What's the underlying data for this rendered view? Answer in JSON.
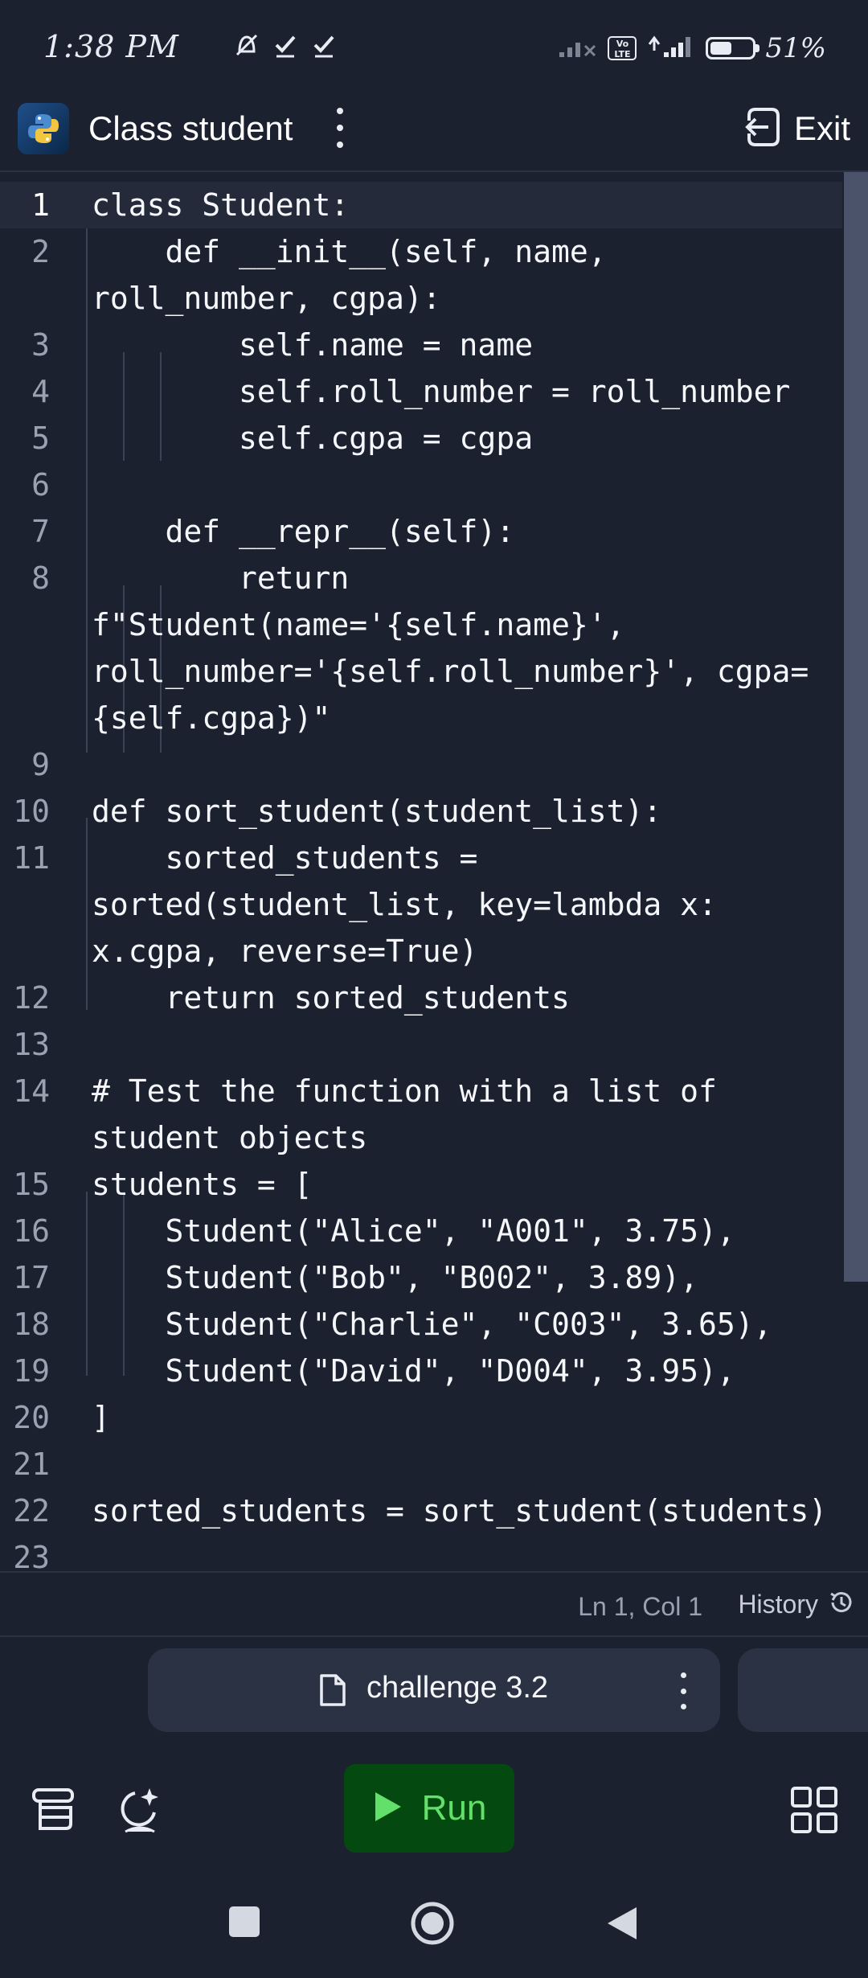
{
  "status_bar": {
    "time": "1:38 PM",
    "battery_text": "51%",
    "battery_level_percent": 51,
    "network_badge": "Vo LTE",
    "icons": [
      "dnd-icon",
      "check-icon",
      "check-icon",
      "signal-icon",
      "signal-icon"
    ]
  },
  "header": {
    "title": "Class student",
    "exit_label": "Exit",
    "logo_icon": "python-logo"
  },
  "editor": {
    "lines": [
      {
        "number": "1",
        "text": "class Student:"
      },
      {
        "number": "2",
        "text": "    def __init__(self, name,"
      },
      {
        "number": "",
        "text": "roll_number, cgpa):"
      },
      {
        "number": "3",
        "text": "        self.name = name"
      },
      {
        "number": "4",
        "text": "        self.roll_number = roll_number"
      },
      {
        "number": "5",
        "text": "        self.cgpa = cgpa"
      },
      {
        "number": "6",
        "text": ""
      },
      {
        "number": "7",
        "text": "    def __repr__(self):"
      },
      {
        "number": "8",
        "text": "        return"
      },
      {
        "number": "",
        "text": "f\"Student(name='{self.name}',"
      },
      {
        "number": "",
        "text": "roll_number='{self.roll_number}', cgpa="
      },
      {
        "number": "",
        "text": "{self.cgpa})\""
      },
      {
        "number": "9",
        "text": ""
      },
      {
        "number": "10",
        "text": "def sort_student(student_list):"
      },
      {
        "number": "11",
        "text": "    sorted_students ="
      },
      {
        "number": "",
        "text": "sorted(student_list, key=lambda x:"
      },
      {
        "number": "",
        "text": "x.cgpa, reverse=True)"
      },
      {
        "number": "12",
        "text": "    return sorted_students"
      },
      {
        "number": "13",
        "text": ""
      },
      {
        "number": "14",
        "text": "# Test the function with a list of"
      },
      {
        "number": "",
        "text": "student objects"
      },
      {
        "number": "15",
        "text": "students = ["
      },
      {
        "number": "16",
        "text": "    Student(\"Alice\", \"A001\", 3.75),"
      },
      {
        "number": "17",
        "text": "    Student(\"Bob\", \"B002\", 3.89),"
      },
      {
        "number": "18",
        "text": "    Student(\"Charlie\", \"C003\", 3.65),"
      },
      {
        "number": "19",
        "text": "    Student(\"David\", \"D004\", 3.95),"
      },
      {
        "number": "20",
        "text": "]"
      },
      {
        "number": "21",
        "text": ""
      },
      {
        "number": "22",
        "text": "sorted_students = sort_student(students)"
      },
      {
        "number": "23",
        "text": ""
      }
    ],
    "active_line": "1"
  },
  "status_line": {
    "cursor_position": "Ln 1, Col 1",
    "history_label": "History"
  },
  "file_tab": {
    "name": "challenge 3.2"
  },
  "toolbar": {
    "run_label": "Run"
  },
  "colors": {
    "background": "#1c2130",
    "run_button": "#044a10",
    "run_text": "#63e06a"
  }
}
